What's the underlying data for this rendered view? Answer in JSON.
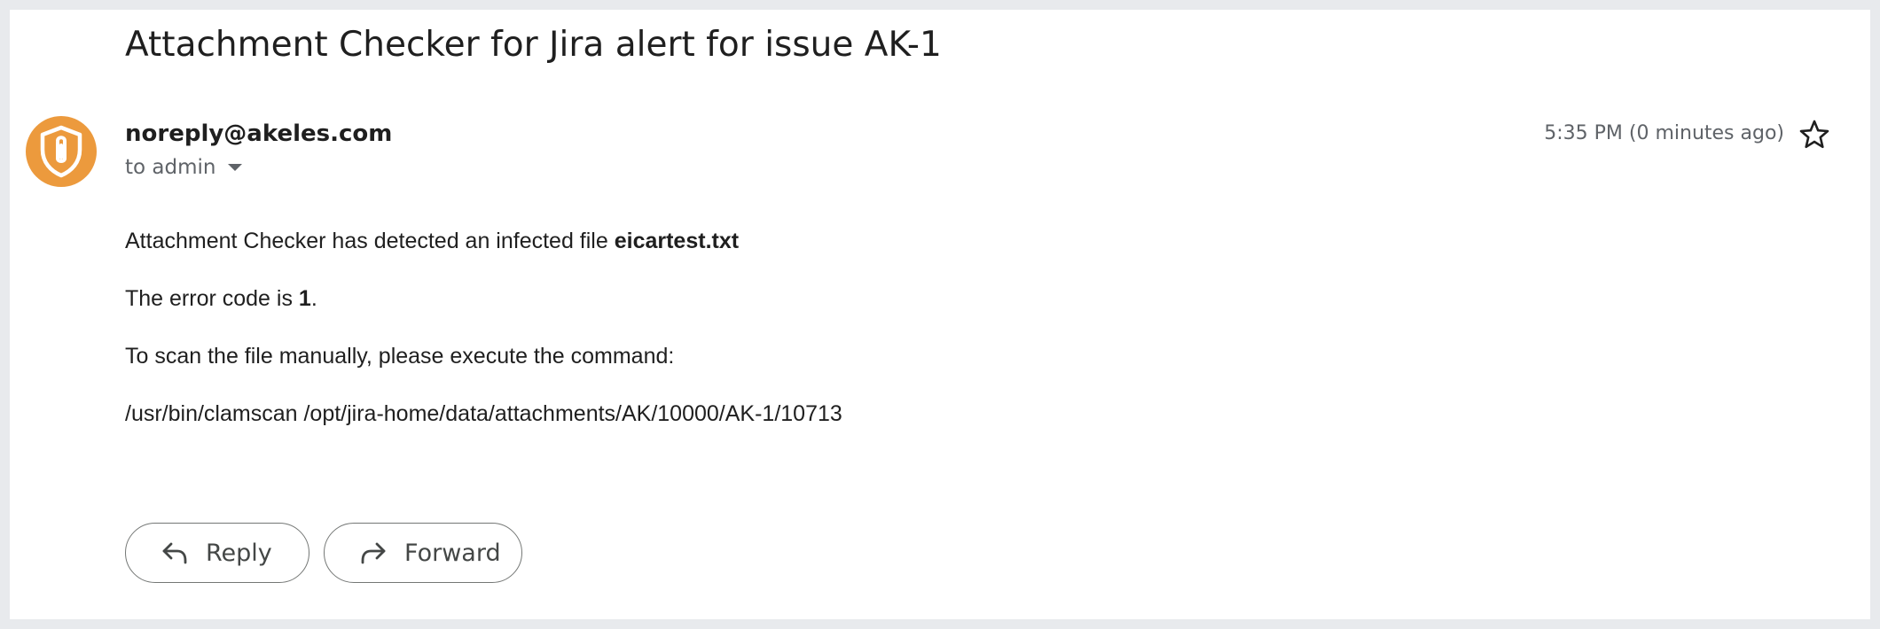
{
  "email": {
    "subject": "Attachment Checker for Jira alert for issue AK-1",
    "sender": "noreply@akeles.com",
    "recipient": "to admin",
    "timestamp": "5:35 PM (0 minutes ago)",
    "avatar_color": "#ec9a3d",
    "avatar_icon": "shield-paperclip-icon",
    "body": {
      "line1_prefix": "Attachment Checker has detected an infected file ",
      "line1_filename": "eicartest.txt",
      "line2_prefix": "The error code is ",
      "line2_code": "1",
      "line2_suffix": ".",
      "line3": "To scan the file manually, please execute the command:",
      "line4": "/usr/bin/clamscan /opt/jira-home/data/attachments/AK/10000/AK-1/10713"
    }
  },
  "actions": {
    "reply_label": "Reply",
    "forward_label": "Forward"
  }
}
